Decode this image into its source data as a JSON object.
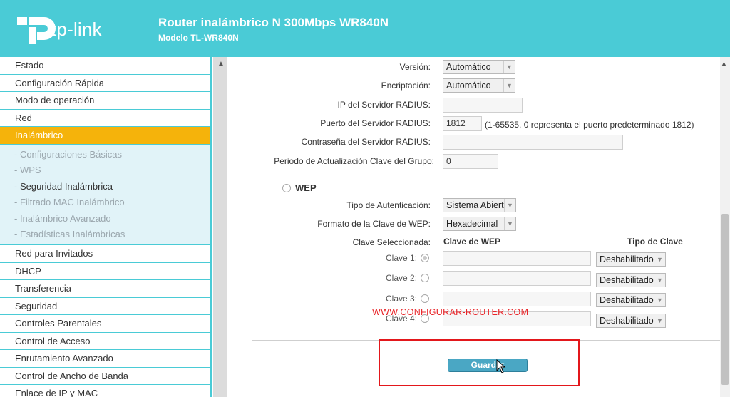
{
  "header": {
    "logo_text": "tp-link",
    "title": "Router inalámbrico N 300Mbps WR840N",
    "subtitle": "Modelo TL-WR840N"
  },
  "sidebar": {
    "items_top": [
      "Estado",
      "Configuración Rápida",
      "Modo de operación",
      "Red"
    ],
    "active": "Inalámbrico",
    "sub_items": [
      "- Configuraciones Básicas",
      "- WPS",
      "- Seguridad Inalámbrica",
      "- Filtrado MAC Inalámbrico",
      "- Inalámbrico Avanzado",
      "- Estadísticas Inalámbricas"
    ],
    "items_bottom": [
      "Red para Invitados",
      "DHCP",
      "Transferencia",
      "Seguridad",
      "Controles Parentales",
      "Control de Acceso",
      "Enrutamiento Avanzado",
      "Control de Ancho de Banda",
      "Enlace de IP y MAC"
    ]
  },
  "radius": {
    "version_label": "Versión:",
    "version_value": "Automático",
    "encryption_label": "Encriptación:",
    "encryption_value": "Automático",
    "server_ip_label": "IP del Servidor RADIUS:",
    "server_ip_value": "",
    "server_port_label": "Puerto del Servidor RADIUS:",
    "server_port_value": "1812",
    "server_port_hint": "(1-65535, 0 representa el puerto predeterminado 1812)",
    "server_password_label": "Contraseña del Servidor RADIUS:",
    "server_password_value": "",
    "group_key_label": "Periodo de Actualización Clave del Grupo:",
    "group_key_value": "0"
  },
  "wep": {
    "label": "WEP",
    "auth_type_label": "Tipo de Autenticación:",
    "auth_type_value": "Sistema Abiert",
    "key_format_label": "Formato de la Clave de WEP:",
    "key_format_value": "Hexadecimal",
    "selected_key_label": "Clave Seleccionada:",
    "col_wep_key": "Clave de WEP",
    "col_key_type": "Tipo de Clave",
    "keys": [
      {
        "label": "Clave 1:",
        "value": "",
        "type": "Deshabilitado"
      },
      {
        "label": "Clave 2:",
        "value": "",
        "type": "Deshabilitado"
      },
      {
        "label": "Clave 3:",
        "value": "",
        "type": "Deshabilitado"
      },
      {
        "label": "Clave 4:",
        "value": "",
        "type": "Deshabilitado"
      }
    ]
  },
  "watermark": "WWW.CONFIGURAR-ROUTER.COM",
  "save_label": "Guardar",
  "colors": {
    "header": "#4acbd6",
    "active_menu": "#f5b30b",
    "submenu_bg": "#e1f3f8",
    "save_button": "#4aa7c4",
    "highlight": "#e3171b"
  }
}
